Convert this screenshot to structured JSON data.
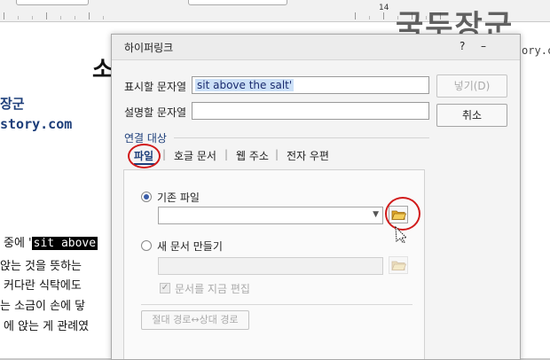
{
  "ruler": {
    "numbers": [
      "14"
    ]
  },
  "document": {
    "title_fragment": "소",
    "line_author": "장군",
    "line_site": "story.com",
    "line1_prefix": "중에 '",
    "line1_highlight": "sit above",
    "line2": "앉는 것을 뜻하는",
    "line3": "커다란 식탁에도",
    "line4": "는 소금이 손에 닿",
    "line5": "에 앉는 게 관례였"
  },
  "watermark": {
    "title": "국두장군",
    "url": "http://mainia.tistory.com"
  },
  "dialog": {
    "title": "하이퍼링크",
    "display_text_label": "표시할 문자열",
    "display_text_value": "sit above the salt'",
    "desc_label": "설명할 문자열",
    "desc_value": "",
    "insert_button": "넣기(D)",
    "cancel_button": "취소",
    "link_target_label": "연결 대상",
    "tabs": [
      "파일",
      "호글 문서",
      "웹 주소",
      "전자 우편"
    ],
    "existing_file_label": "기존 파일",
    "new_doc_label": "새 문서 만들기",
    "edit_now_label": "문서를 지금 편집",
    "path_toggle_button": "절대 경로↔상대 경로"
  },
  "colors": {
    "highlight_circle": "#d11a1a",
    "selection": "#cce0f7",
    "section": "#1d3e7a"
  }
}
